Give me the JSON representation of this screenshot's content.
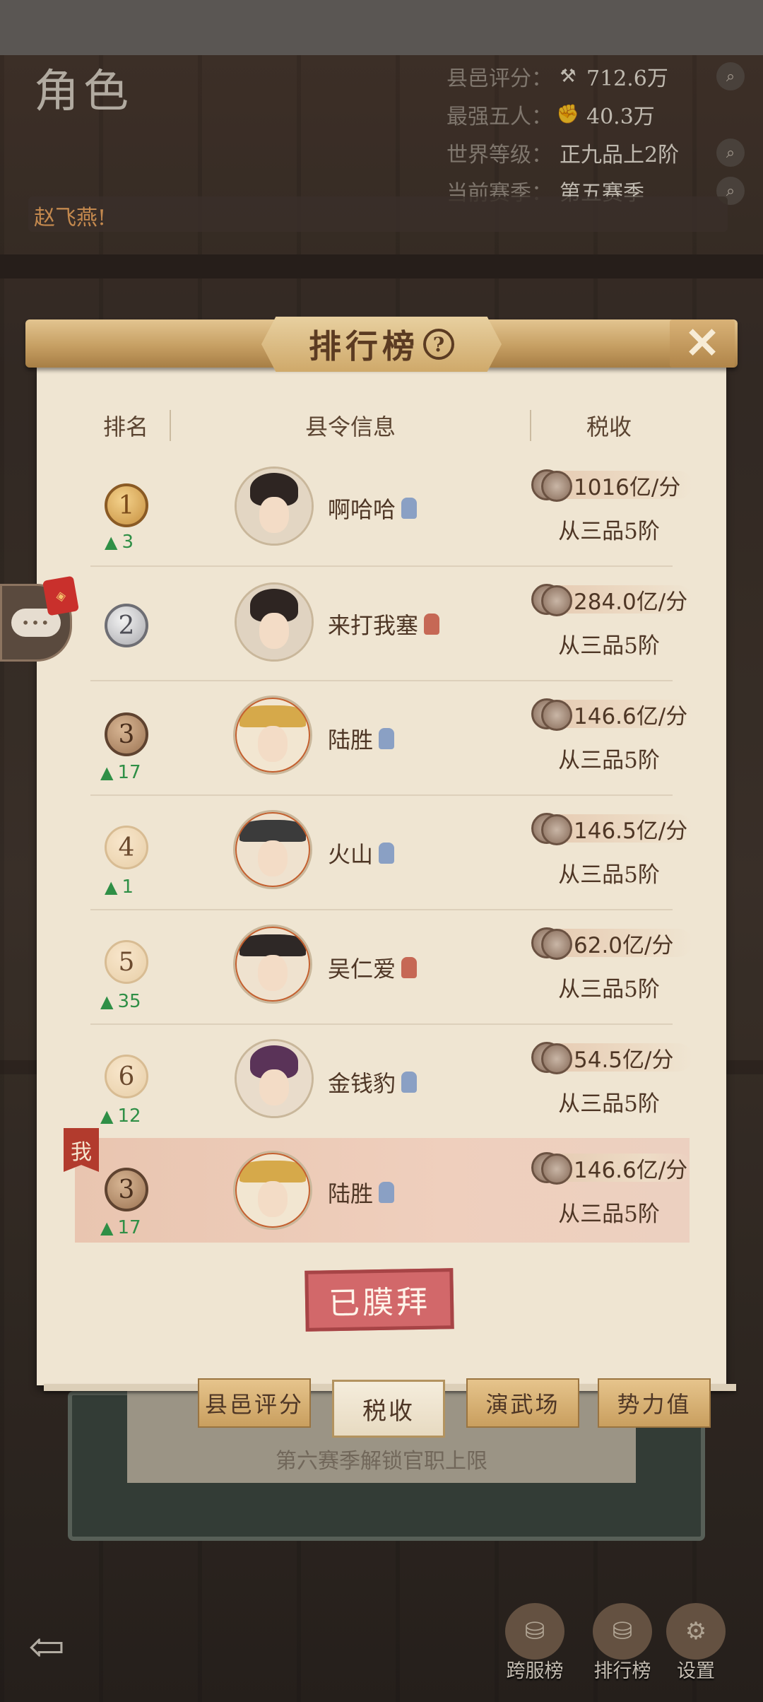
{
  "header": {
    "title": "角色",
    "stats": [
      {
        "label": "县邑评分：",
        "icon": "hammer-icon",
        "value": "712.6万"
      },
      {
        "label": "最强五人：",
        "icon": "fist-icon",
        "value": "40.3万"
      },
      {
        "label": "世界等级：",
        "icon": "",
        "value": "正九品上2阶"
      },
      {
        "label": "当前赛季：",
        "icon": "",
        "value": "第五赛季"
      }
    ]
  },
  "chat": {
    "name": "赵飞燕!"
  },
  "modal": {
    "title": "排行榜",
    "columns": [
      "排名",
      "县令信息",
      "税收"
    ],
    "rows": [
      {
        "rank": "1",
        "change": "3",
        "name": "啊哈哈",
        "gender": "male",
        "tax": "1016亿/分",
        "grade": "从三品5阶"
      },
      {
        "rank": "2",
        "change": "",
        "name": "来打我塞",
        "gender": "female",
        "tax": "284.0亿/分",
        "grade": "从三品5阶"
      },
      {
        "rank": "3",
        "change": "17",
        "name": "陆胜",
        "gender": "male",
        "tax": "146.6亿/分",
        "grade": "从三品5阶"
      },
      {
        "rank": "4",
        "change": "1",
        "name": "火山",
        "gender": "male",
        "tax": "146.5亿/分",
        "grade": "从三品5阶"
      },
      {
        "rank": "5",
        "change": "35",
        "name": "吴仁爱",
        "gender": "female",
        "tax": "62.0亿/分",
        "grade": "从三品5阶"
      },
      {
        "rank": "6",
        "change": "12",
        "name": "金钱豹",
        "gender": "male",
        "tax": "54.5亿/分",
        "grade": "从三品5阶"
      }
    ],
    "me": {
      "flag": "我",
      "rank": "3",
      "change": "17",
      "name": "陆胜",
      "gender": "male",
      "tax": "146.6亿/分",
      "grade": "从三品5阶"
    },
    "worship_button": "已膜拜",
    "tabs": [
      "县邑评分",
      "税收",
      "演武场",
      "势力值"
    ],
    "active_tab": "税收"
  },
  "footer": {
    "unlock_text": "第六赛季解锁官职上限",
    "nav": [
      {
        "label": "跨服榜",
        "icon": "cross-server-icon"
      },
      {
        "label": "排行榜",
        "icon": "ranking-icon"
      },
      {
        "label": "设置",
        "icon": "gear-icon"
      }
    ]
  }
}
